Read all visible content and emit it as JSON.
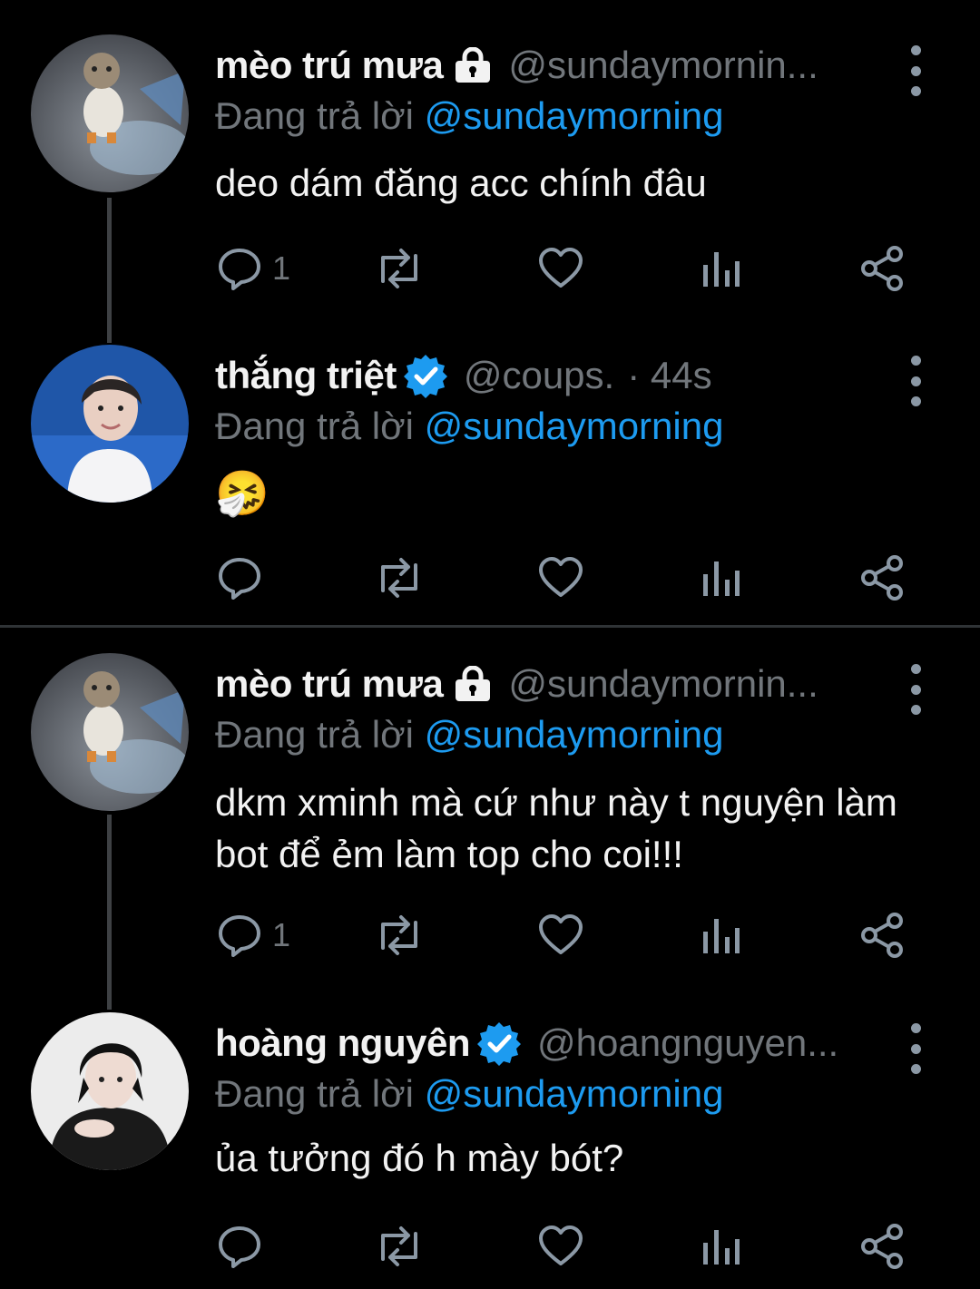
{
  "tweets": [
    {
      "name": "mèo trú mưa",
      "handle": "@sundaymornin...",
      "time": "",
      "replying_prefix": "Đang trả lời",
      "replying_to": "@sundaymorning",
      "text": "deo dám đăng acc chính đâu",
      "reply_count": "1",
      "badge": "lock-icon"
    },
    {
      "name": "thắng triệt",
      "handle": "@coups.",
      "time": "· 44s",
      "replying_prefix": "Đang trả lời",
      "replying_to": "@sundaymorning",
      "text": "🤧",
      "reply_count": "",
      "badge": "verified-icon"
    },
    {
      "name": "mèo trú mưa",
      "handle": "@sundaymornin...",
      "time": "",
      "replying_prefix": "Đang trả lời",
      "replying_to": "@sundaymorning",
      "text": "dkm xminh mà cứ như này t nguyện làm bot để ẻm làm top cho coi!!!",
      "reply_count": "1",
      "badge": "lock-icon"
    },
    {
      "name": "hoàng nguyên",
      "handle": "@hoangnguyen...",
      "time": "",
      "replying_prefix": "Đang trả lời",
      "replying_to": "@sundaymorning",
      "text": "ủa tưởng đó h mày bót?",
      "reply_count": "",
      "badge": "verified-icon"
    }
  ],
  "colors": {
    "background": "#000000",
    "mention": "#1d9bf0",
    "muted": "#71767b",
    "icon": "#8b98a5",
    "verified": "#1d9bf0"
  }
}
